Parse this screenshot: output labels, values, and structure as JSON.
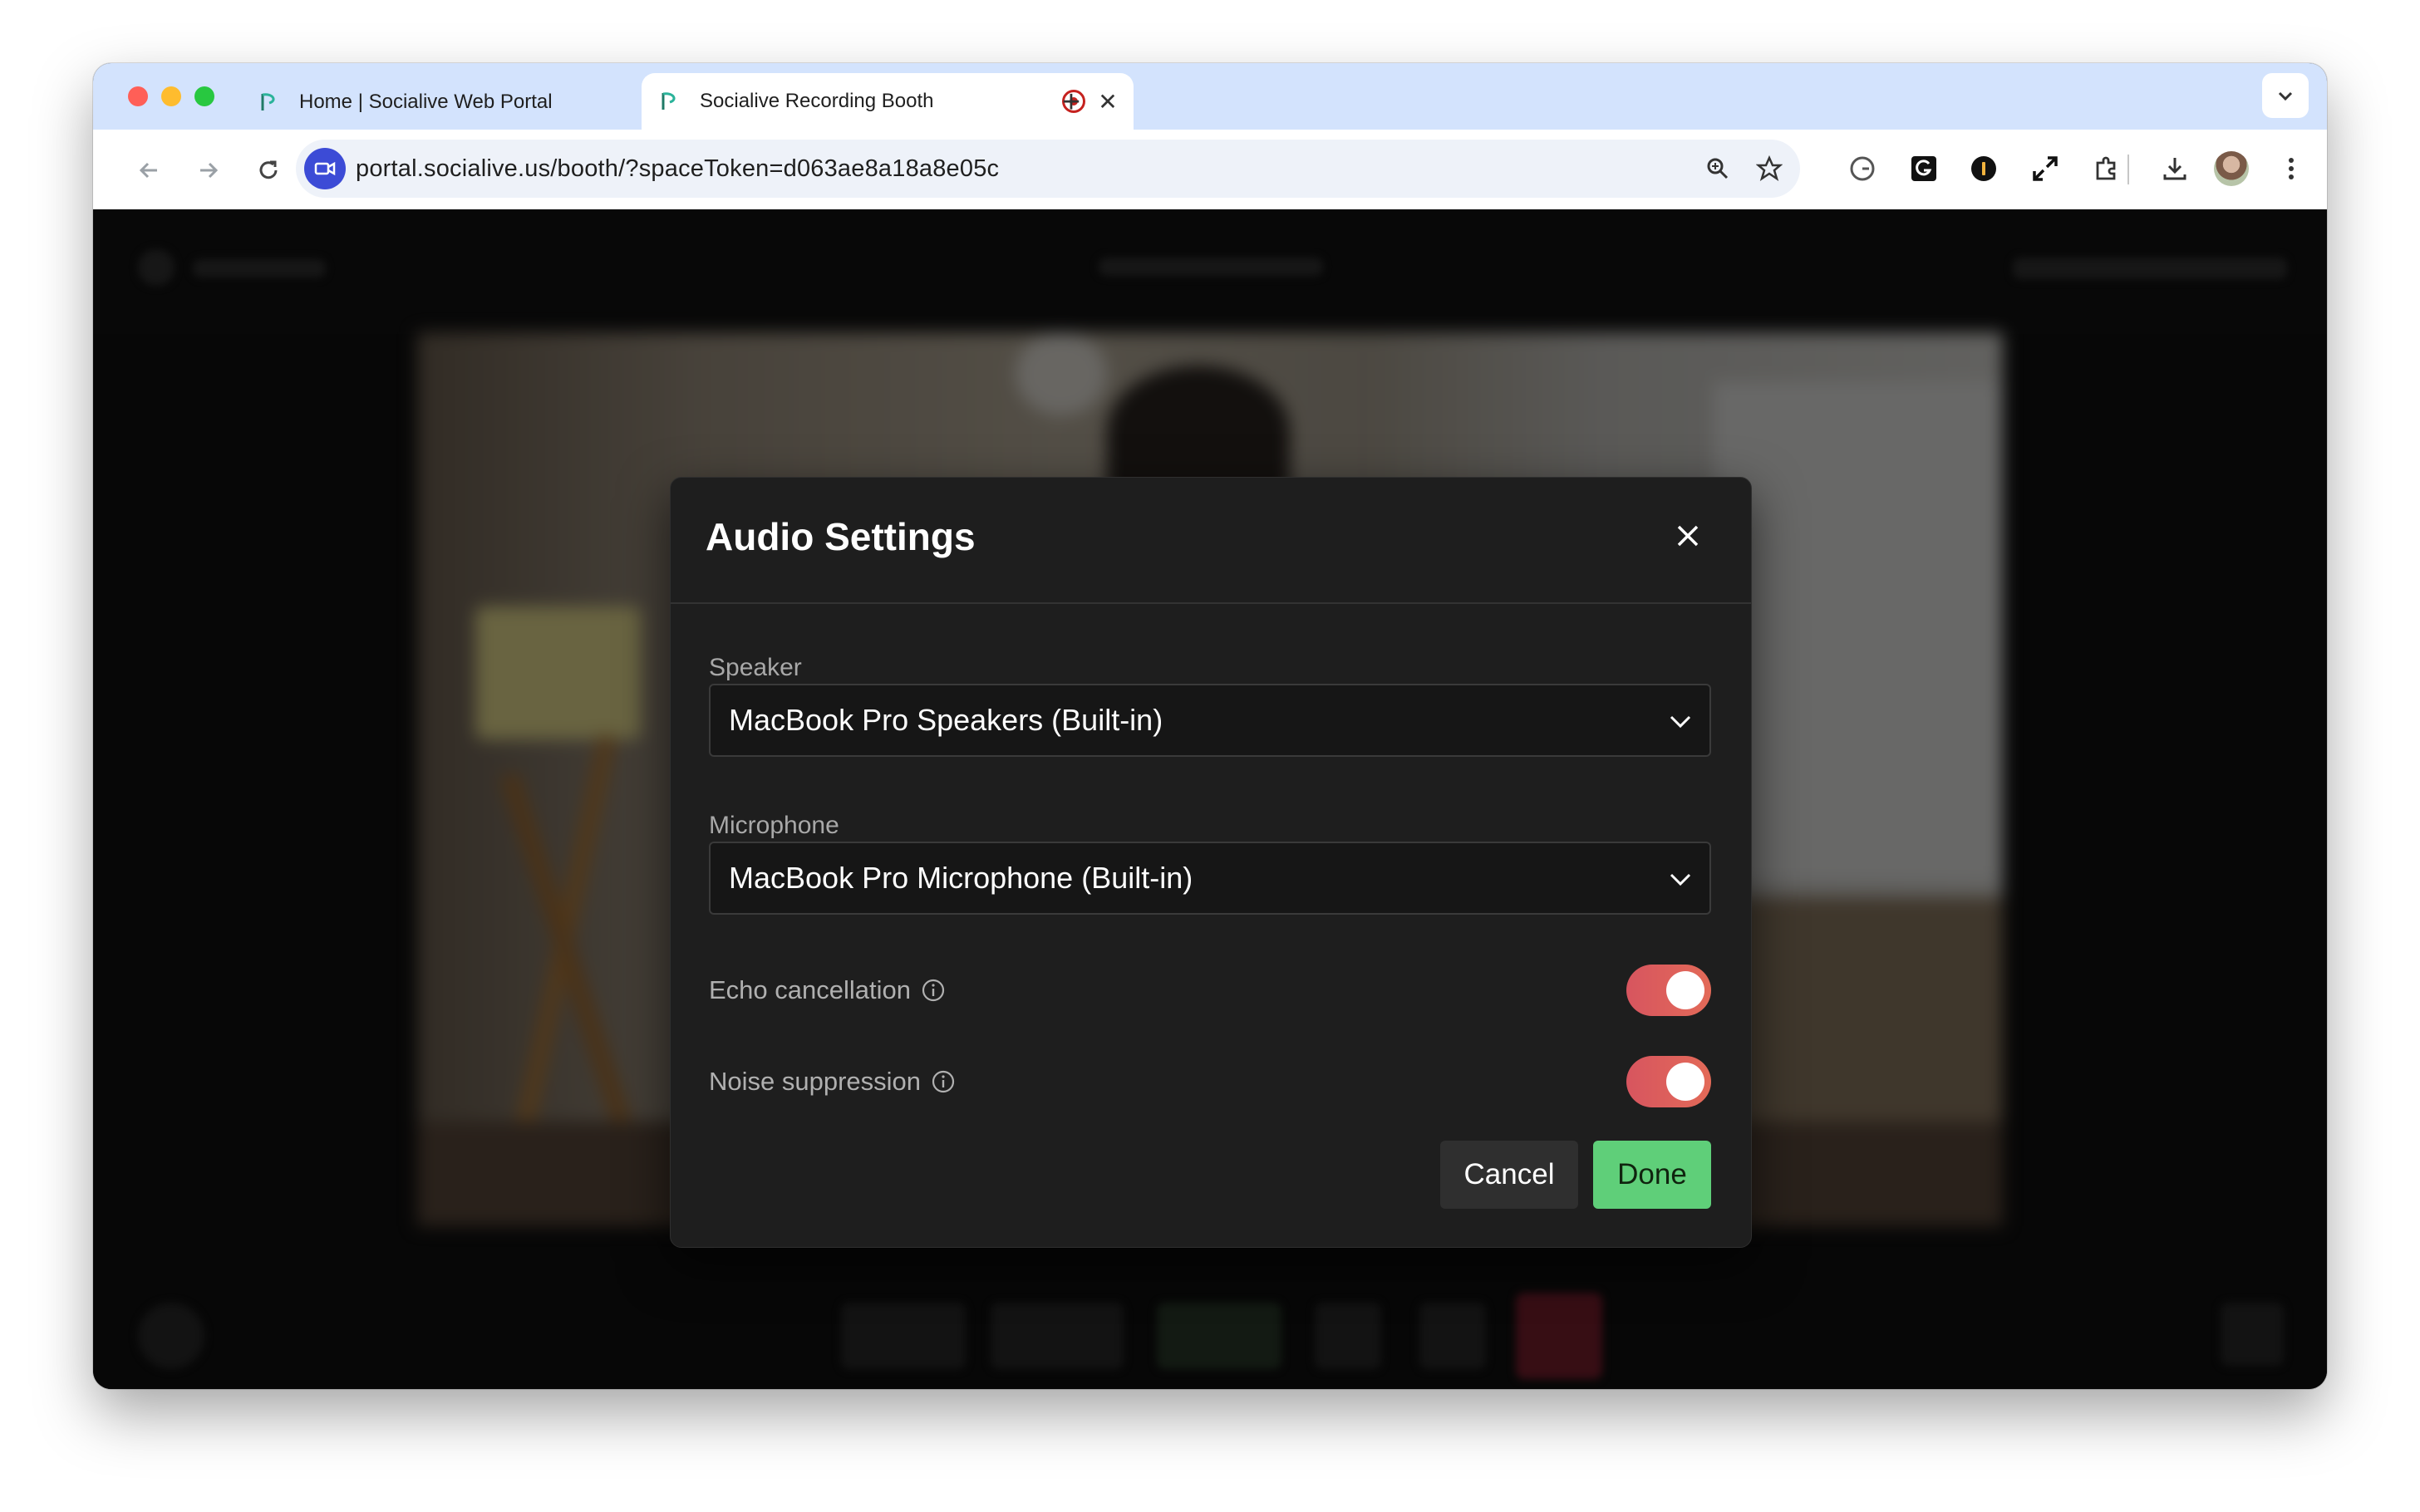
{
  "browser": {
    "tabs": [
      {
        "title": "Home | Socialive Web Portal",
        "active": false
      },
      {
        "title": "Socialive Recording Booth",
        "active": true,
        "recording": true
      }
    ],
    "url": "portal.socialive.us/booth/?spaceToken=d063ae8a18a8e05c"
  },
  "modal": {
    "title": "Audio Settings",
    "speaker": {
      "label": "Speaker",
      "value": "MacBook Pro Speakers (Built-in)"
    },
    "microphone": {
      "label": "Microphone",
      "value": "MacBook Pro Microphone (Built-in)"
    },
    "toggles": [
      {
        "label": "Echo cancellation",
        "on": true
      },
      {
        "label": "Noise suppression",
        "on": true
      }
    ],
    "cancel_label": "Cancel",
    "done_label": "Done"
  },
  "colors": {
    "toggle_on": "#e0605a",
    "done_button": "#5fcf79",
    "modal_bg": "#1e1e1e",
    "tabstrip": "#d3e3fd"
  }
}
